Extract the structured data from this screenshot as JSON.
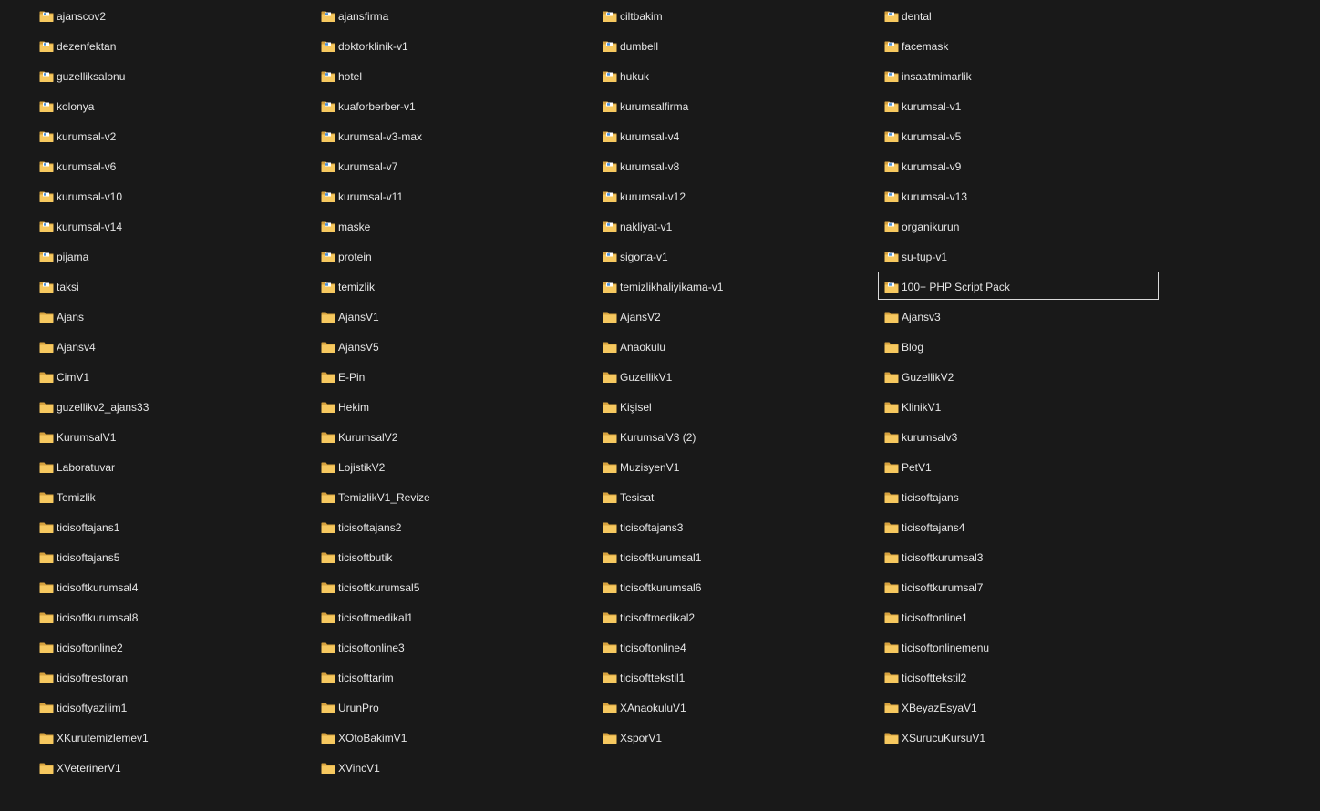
{
  "explorer": {
    "selected_index": 39,
    "folder_color": "#f6c85f",
    "folder_dark_color": "#d7a23d",
    "overlay_color": "#4a90d9",
    "folders": [
      {
        "name": "ajanscov2",
        "overlay": true
      },
      {
        "name": "ajansfirma",
        "overlay": true
      },
      {
        "name": "ciltbakim",
        "overlay": true
      },
      {
        "name": "dental",
        "overlay": true
      },
      {
        "name": "dezenfektan",
        "overlay": true
      },
      {
        "name": "doktorklinik-v1",
        "overlay": true
      },
      {
        "name": "dumbell",
        "overlay": true
      },
      {
        "name": "facemask",
        "overlay": true
      },
      {
        "name": "guzelliksalonu",
        "overlay": true
      },
      {
        "name": "hotel",
        "overlay": true
      },
      {
        "name": "hukuk",
        "overlay": true
      },
      {
        "name": "insaatmimarlik",
        "overlay": true
      },
      {
        "name": "kolonya",
        "overlay": true
      },
      {
        "name": "kuaforberber-v1",
        "overlay": true
      },
      {
        "name": "kurumsalfirma",
        "overlay": true
      },
      {
        "name": "kurumsal-v1",
        "overlay": true
      },
      {
        "name": "kurumsal-v2",
        "overlay": true
      },
      {
        "name": "kurumsal-v3-max",
        "overlay": true
      },
      {
        "name": "kurumsal-v4",
        "overlay": true
      },
      {
        "name": "kurumsal-v5",
        "overlay": true
      },
      {
        "name": "kurumsal-v6",
        "overlay": true
      },
      {
        "name": "kurumsal-v7",
        "overlay": true
      },
      {
        "name": "kurumsal-v8",
        "overlay": true
      },
      {
        "name": "kurumsal-v9",
        "overlay": true
      },
      {
        "name": "kurumsal-v10",
        "overlay": true
      },
      {
        "name": "kurumsal-v11",
        "overlay": true
      },
      {
        "name": "kurumsal-v12",
        "overlay": true
      },
      {
        "name": "kurumsal-v13",
        "overlay": true
      },
      {
        "name": "kurumsal-v14",
        "overlay": true
      },
      {
        "name": "maske",
        "overlay": true
      },
      {
        "name": "nakliyat-v1",
        "overlay": true
      },
      {
        "name": "organikurun",
        "overlay": true
      },
      {
        "name": "pijama",
        "overlay": true
      },
      {
        "name": "protein",
        "overlay": true
      },
      {
        "name": "sigorta-v1",
        "overlay": true
      },
      {
        "name": "su-tup-v1",
        "overlay": true
      },
      {
        "name": "taksi",
        "overlay": true
      },
      {
        "name": "temizlik",
        "overlay": true
      },
      {
        "name": "temizlikhaliyikama-v1",
        "overlay": true
      },
      {
        "name": "100+ PHP Script Pack",
        "overlay": true
      },
      {
        "name": "Ajans",
        "overlay": false
      },
      {
        "name": "AjansV1",
        "overlay": false
      },
      {
        "name": "AjansV2",
        "overlay": false
      },
      {
        "name": "Ajansv3",
        "overlay": false
      },
      {
        "name": "Ajansv4",
        "overlay": false
      },
      {
        "name": "AjansV5",
        "overlay": false
      },
      {
        "name": "Anaokulu",
        "overlay": false
      },
      {
        "name": "Blog",
        "overlay": false
      },
      {
        "name": "CimV1",
        "overlay": false
      },
      {
        "name": "E-Pin",
        "overlay": false
      },
      {
        "name": "GuzellikV1",
        "overlay": false
      },
      {
        "name": "GuzellikV2",
        "overlay": false
      },
      {
        "name": "guzellikv2_ajans33",
        "overlay": false
      },
      {
        "name": "Hekim",
        "overlay": false
      },
      {
        "name": "Kişisel",
        "overlay": false
      },
      {
        "name": "KlinikV1",
        "overlay": false
      },
      {
        "name": "KurumsalV1",
        "overlay": false
      },
      {
        "name": "KurumsalV2",
        "overlay": false
      },
      {
        "name": "KurumsalV3 (2)",
        "overlay": false
      },
      {
        "name": "kurumsalv3",
        "overlay": false
      },
      {
        "name": "Laboratuvar",
        "overlay": false
      },
      {
        "name": "LojistikV2",
        "overlay": false
      },
      {
        "name": "MuzisyenV1",
        "overlay": false
      },
      {
        "name": "PetV1",
        "overlay": false
      },
      {
        "name": "Temizlik",
        "overlay": false
      },
      {
        "name": "TemizlikV1_Revize",
        "overlay": false
      },
      {
        "name": "Tesisat",
        "overlay": false
      },
      {
        "name": "ticisoftajans",
        "overlay": false
      },
      {
        "name": "ticisoftajans1",
        "overlay": false
      },
      {
        "name": "ticisoftajans2",
        "overlay": false
      },
      {
        "name": "ticisoftajans3",
        "overlay": false
      },
      {
        "name": "ticisoftajans4",
        "overlay": false
      },
      {
        "name": "ticisoftajans5",
        "overlay": false
      },
      {
        "name": "ticisoftbutik",
        "overlay": false
      },
      {
        "name": "ticisoftkurumsal1",
        "overlay": false
      },
      {
        "name": "ticisoftkurumsal3",
        "overlay": false
      },
      {
        "name": "ticisoftkurumsal4",
        "overlay": false
      },
      {
        "name": "ticisoftkurumsal5",
        "overlay": false
      },
      {
        "name": "ticisoftkurumsal6",
        "overlay": false
      },
      {
        "name": "ticisoftkurumsal7",
        "overlay": false
      },
      {
        "name": "ticisoftkurumsal8",
        "overlay": false
      },
      {
        "name": "ticisoftmedikal1",
        "overlay": false
      },
      {
        "name": "ticisoftmedikal2",
        "overlay": false
      },
      {
        "name": "ticisoftonline1",
        "overlay": false
      },
      {
        "name": "ticisoftonline2",
        "overlay": false
      },
      {
        "name": "ticisoftonline3",
        "overlay": false
      },
      {
        "name": "ticisoftonline4",
        "overlay": false
      },
      {
        "name": "ticisoftonlinemenu",
        "overlay": false
      },
      {
        "name": "ticisoftrestoran",
        "overlay": false
      },
      {
        "name": "ticisofttarim",
        "overlay": false
      },
      {
        "name": "ticisofttekstil1",
        "overlay": false
      },
      {
        "name": "ticisofttekstil2",
        "overlay": false
      },
      {
        "name": "ticisoftyazilim1",
        "overlay": false
      },
      {
        "name": "UrunPro",
        "overlay": false
      },
      {
        "name": "XAnaokuluV1",
        "overlay": false
      },
      {
        "name": "XBeyazEsyaV1",
        "overlay": false
      },
      {
        "name": "XKurutemizlemev1",
        "overlay": false
      },
      {
        "name": "XOtoBakimV1",
        "overlay": false
      },
      {
        "name": "XsporV1",
        "overlay": false
      },
      {
        "name": "XSurucuKursuV1",
        "overlay": false
      },
      {
        "name": "XVeterinerV1",
        "overlay": false
      },
      {
        "name": "XVincV1",
        "overlay": false
      }
    ]
  }
}
